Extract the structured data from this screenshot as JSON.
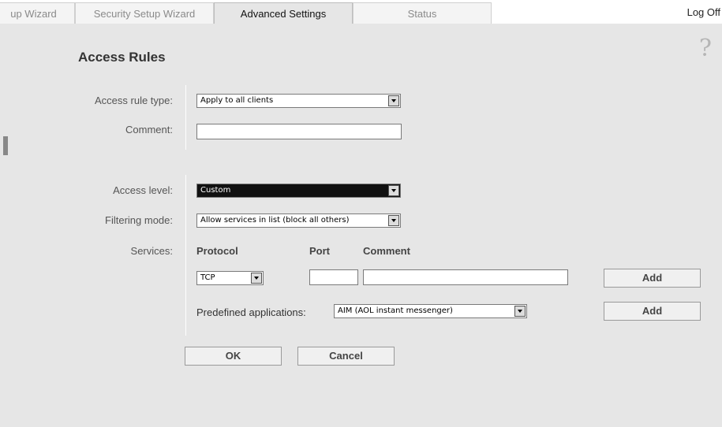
{
  "tabs": [
    {
      "label": "up Wizard"
    },
    {
      "label": "Security Setup Wizard"
    },
    {
      "label": "Advanced Settings"
    },
    {
      "label": "Status"
    }
  ],
  "header": {
    "logoff": "Log Off",
    "help": "?"
  },
  "page": {
    "title": "Access Rules"
  },
  "form": {
    "access_rule_type_label": "Access rule type:",
    "access_rule_type_value": "Apply to all clients",
    "comment_label": "Comment:",
    "comment_value": "",
    "access_level_label": "Access level:",
    "access_level_value": "Custom",
    "filtering_mode_label": "Filtering mode:",
    "filtering_mode_value": "Allow services in list (block all others)",
    "services_label": "Services:",
    "col_protocol": "Protocol",
    "col_port": "Port",
    "col_comment": "Comment",
    "protocol_value": "TCP",
    "port_value": "",
    "service_comment_value": "",
    "add_label": "Add",
    "predefined_label": "Predefined applications:",
    "predefined_value": "AIM (AOL instant messenger)",
    "add2_label": "Add",
    "ok_label": "OK",
    "cancel_label": "Cancel"
  }
}
